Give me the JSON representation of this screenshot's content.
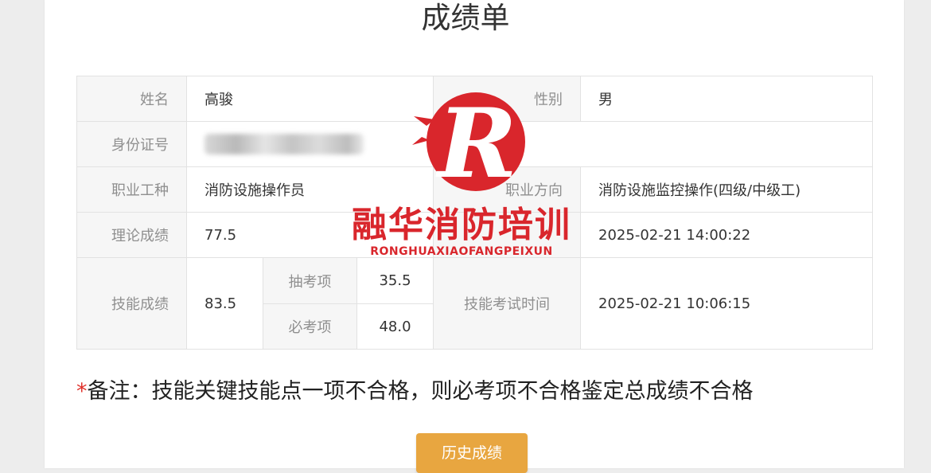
{
  "page": {
    "title": "成绩单"
  },
  "grades": {
    "name_label": "姓名",
    "name_value": "高骏",
    "gender_label": "性别",
    "gender_value": "男",
    "id_label": "身份证号",
    "occupation_label": "职业工种",
    "occupation_value": "消防设施操作员",
    "direction_label": "职业方向",
    "direction_value": "消防设施监控操作(四级/中级工)",
    "theory_label": "理论成绩",
    "theory_value": "77.5",
    "theory_time_value": "2025-02-21 14:00:22",
    "skill_label": "技能成绩",
    "skill_value": "83.5",
    "draw_item_label": "抽考项",
    "draw_item_value": "35.5",
    "required_item_label": "必考项",
    "required_item_value": "48.0",
    "skill_time_label": "技能考试时间",
    "skill_time_value": "2025-02-21 10:06:15"
  },
  "note": {
    "star": "*",
    "text": "备注：技能关键技能点一项不合格，则必考项不合格鉴定总成绩不合格"
  },
  "actions": {
    "history_label": "历史成绩"
  },
  "watermark": {
    "text": "融华消防培训",
    "sub": "RONGHUAXIAOFANGPEIXUN",
    "logo_letter": "R"
  },
  "colors": {
    "accent_button": "#e8a640",
    "skill_score": "#4a9bb0",
    "watermark": "#d9262c",
    "note_star": "#e0302a"
  }
}
